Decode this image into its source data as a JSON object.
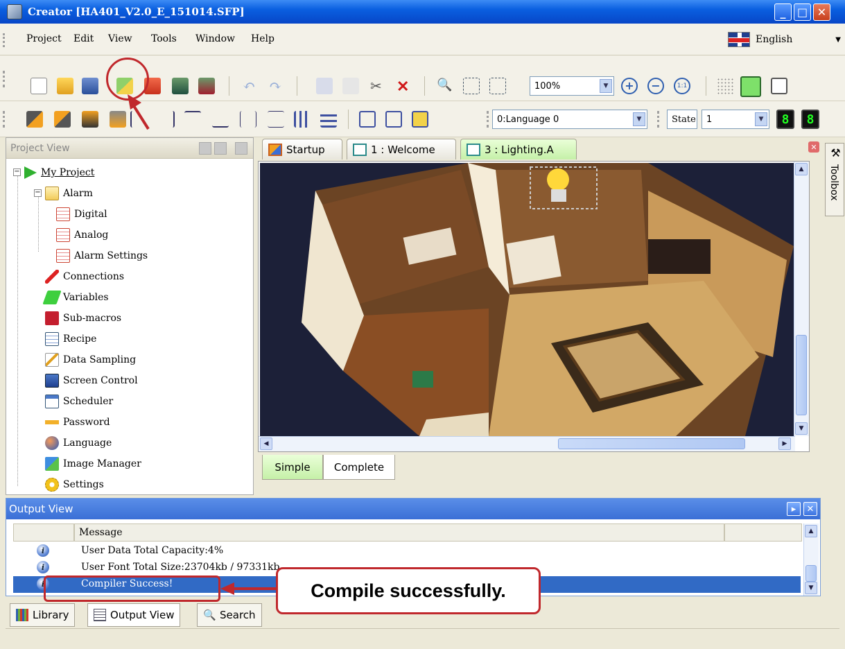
{
  "window": {
    "title": "Creator [HA401_V2.0_E_151014.SFP]"
  },
  "menu": {
    "items": [
      "Project",
      "Edit",
      "View",
      "Tools",
      "Window",
      "Help"
    ],
    "language": "English"
  },
  "toolbar": {
    "zoom": "100%",
    "language_combo": "0:Language 0",
    "state_label": "State",
    "state_value": "1",
    "seg1": "8",
    "seg2": "8"
  },
  "project_view": {
    "title": "Project View",
    "root": "My Project",
    "alarm": {
      "label": "Alarm",
      "children": [
        "Digital",
        "Analog",
        "Alarm Settings"
      ]
    },
    "items": [
      "Connections",
      "Variables",
      "Sub-macros",
      "Recipe",
      "Data Sampling",
      "Screen Control",
      "Scheduler",
      "Password",
      "Language",
      "Image Manager",
      "Settings"
    ]
  },
  "editor": {
    "tabs": [
      "Startup",
      "1 : Welcome",
      "3 : Lighting.A"
    ],
    "mode_tabs": [
      "Simple",
      "Complete"
    ]
  },
  "toolbox": {
    "label": "Toolbox"
  },
  "output_view": {
    "title": "Output View",
    "column": "Message",
    "rows": [
      "User Data Total Capacity:4%",
      "User Font Total Size:23704kb / 97331kb",
      "Compiler Success!"
    ]
  },
  "bottom_tabs": [
    "Library",
    "Output View",
    "Search"
  ],
  "annotation": {
    "callout": "Compile successfully."
  },
  "colors": {
    "accent": "#c0282c",
    "titlebar": "#0a5fe0",
    "selection": "#316ac5",
    "active_tab": "#c5f0a8"
  }
}
